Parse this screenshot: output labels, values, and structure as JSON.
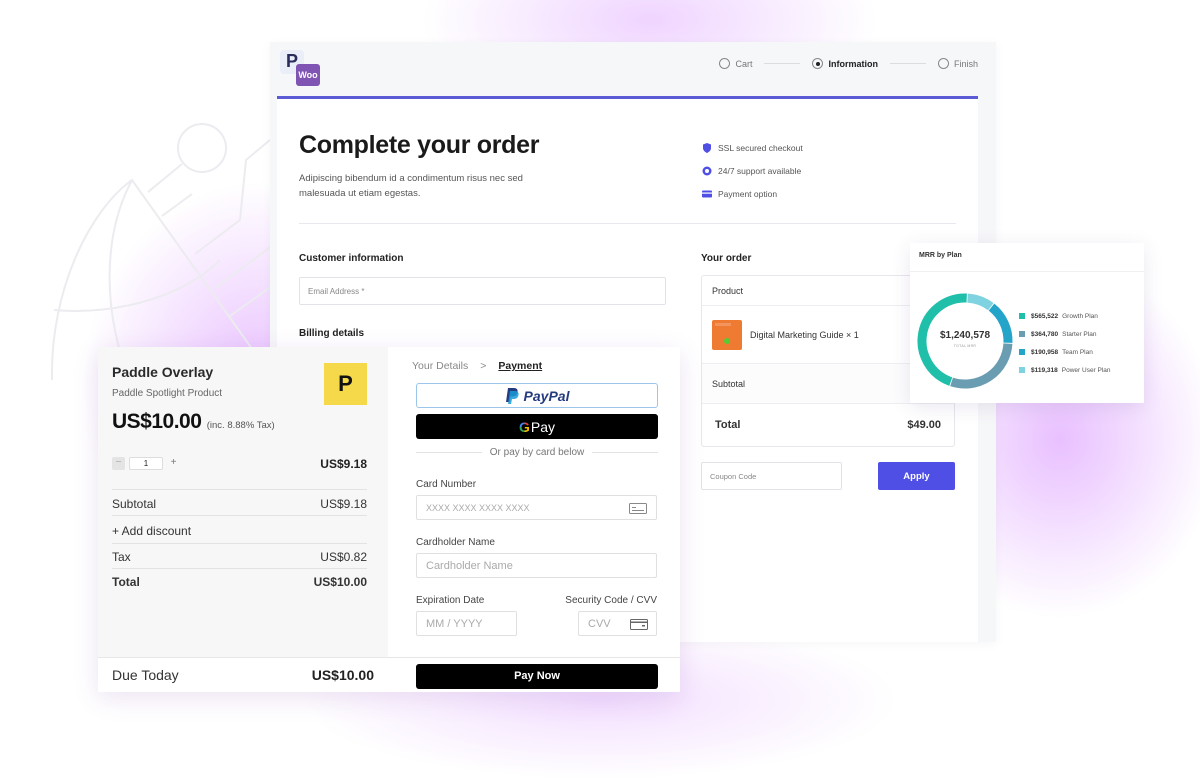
{
  "woo_checkout": {
    "logo": {
      "p_mark": "P",
      "woo_mark": "Woo"
    },
    "steps": [
      {
        "label": "Cart",
        "active": false
      },
      {
        "label": "Information",
        "active": true
      },
      {
        "label": "Finish",
        "active": false
      }
    ],
    "title": "Complete your order",
    "subtitle": "Adipiscing bibendum id a condimentum risus nec sed malesuada ut etiam egestas.",
    "features": [
      {
        "icon": "shield-icon",
        "label": "SSL secured checkout"
      },
      {
        "icon": "support-icon",
        "label": "24/7 support available"
      },
      {
        "icon": "card-icon",
        "label": "Payment option"
      }
    ],
    "customer_info_heading": "Customer information",
    "email_placeholder": "Email Address *",
    "billing_heading": "Billing details",
    "order": {
      "heading": "Your order",
      "product_header": "Product",
      "item": "Digital Marketing Guide × 1",
      "subtotal_label": "Subtotal",
      "total_label": "Total",
      "total_value": "$49.00"
    },
    "coupon_placeholder": "Coupon Code",
    "apply_label": "Apply",
    "accent_color": "#4f4fe6"
  },
  "mrr_card": {
    "title": "MRR by Plan",
    "total_value": "$1,240,578",
    "total_label": "TOTAL MRR"
  },
  "chart_data": {
    "type": "pie",
    "title": "MRR by Plan",
    "center_label": "$1,240,578 TOTAL MRR",
    "legend_position": "right",
    "series": [
      {
        "name": "Growth Plan",
        "value": 565522,
        "display": "$565,522",
        "color": "#1fbfa9"
      },
      {
        "name": "Starter Plan",
        "value": 364780,
        "display": "$364,780",
        "color": "#6b9db2"
      },
      {
        "name": "Team Plan",
        "value": 190958,
        "display": "$190,958",
        "color": "#23a4c8"
      },
      {
        "name": "Power User Plan",
        "value": 119318,
        "display": "$119,318",
        "color": "#7fd3e0"
      }
    ]
  },
  "paddle": {
    "title": "Paddle Overlay",
    "product": "Paddle Spotlight Product",
    "logo_mark": "P",
    "price": "US$10.00",
    "tax_note": "(inc. 8.88% Tax)",
    "quantity": "1",
    "line_price": "US$9.18",
    "summary": [
      {
        "label": "Subtotal",
        "value": "US$9.18"
      },
      {
        "label": "+ Add discount",
        "value": ""
      },
      {
        "label": "Tax",
        "value": "US$0.82"
      },
      {
        "label": "Total",
        "value": "US$10.00"
      }
    ],
    "due_label": "Due Today",
    "due_value": "US$10.00",
    "breadcrumb": {
      "step1": "Your Details",
      "sep": ">",
      "step2": "Payment"
    },
    "paypal_label": "PayPal",
    "gpay_label": "Pay",
    "divider_text": "Or pay by card below",
    "card_number_label": "Card Number",
    "card_number_placeholder": "XXXX XXXX XXXX XXXX",
    "cardholder_label": "Cardholder Name",
    "cardholder_placeholder": "Cardholder Name",
    "expiry_label": "Expiration Date",
    "expiry_placeholder": "MM / YYYY",
    "cvv_label": "Security Code / CVV",
    "cvv_placeholder": "CVV",
    "pay_now_label": "Pay Now"
  }
}
